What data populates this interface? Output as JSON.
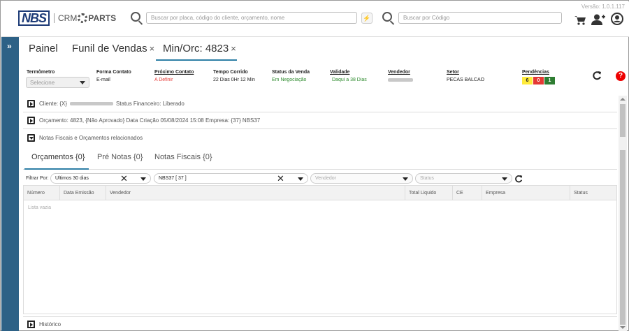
{
  "app": {
    "version": "Versão: 1.0.1.117",
    "logo_nbs": "NBS",
    "logo_crm": "CRM",
    "logo_parts": "PARTS"
  },
  "search": {
    "main_placeholder": "Buscar por placa, código do cliente, orçamento, nome",
    "code_placeholder": "Buscar por Código"
  },
  "tabs": [
    {
      "label": "Painel",
      "closable": false
    },
    {
      "label": "Funil de Vendas",
      "closable": true
    },
    {
      "label": "Min/Orc: 4823",
      "closable": true,
      "active": true
    }
  ],
  "close_glyph": "×",
  "info": {
    "termometro": {
      "label": "Termômetro",
      "value": "Selecione"
    },
    "forma_contato": {
      "label": "Forma Contato",
      "value": "E-mail"
    },
    "proximo_contato": {
      "label": "Próximo Contato",
      "value": "A Definir"
    },
    "tempo_corrido": {
      "label": "Tempo Corrido",
      "value": "22 Dias 0Hr 12 Min"
    },
    "status_venda": {
      "label": "Status da Venda",
      "value": "Em Negociação"
    },
    "validade": {
      "label": "Validade",
      "value": "Daqui a 38 Dias"
    },
    "vendedor": {
      "label": "Vendedor",
      "value": ""
    },
    "setor": {
      "label": "Setor",
      "value": "PECAS BALCAO"
    },
    "pendencias": {
      "label": "Pendências",
      "badges": [
        {
          "value": "6",
          "color": "#ffeb3b",
          "text_color": "#222"
        },
        {
          "value": "0",
          "color": "#e53935",
          "text_color": "#fff"
        },
        {
          "value": "1",
          "color": "#2e7d32",
          "text_color": "#fff"
        }
      ]
    }
  },
  "help_glyph": "?",
  "accordion": {
    "cliente": {
      "prefix": "Cliente: {X}",
      "suffix": "Status Financeiro: Liberado"
    },
    "orcamento": "Orçamento: 4823, {Não Aprovado} Data Criação 05/08/2024 15:08 Empresa: {37} NBS37",
    "notas": "Notas Fiscais e Orçamentos relacionados"
  },
  "subtabs": [
    "Orçamentos {0}",
    "Pré Notas {0}",
    "Notas Fiscais {0}"
  ],
  "filters": {
    "label": "Filtrar Por:",
    "period": "Ultimos 30 dias",
    "empresa": "NBS37 [ 37 ]",
    "vendedor_placeholder": "Vendedor",
    "status_placeholder": "Status"
  },
  "grid": {
    "columns": [
      "Número",
      "Data Emissão",
      "Vendedor",
      "Total Liquido",
      "CE",
      "Empresa",
      "Status"
    ],
    "empty": "Lista vazia"
  },
  "historico": "Histórico",
  "icons": [
    "search-icon",
    "filter-icon",
    "cart-icon",
    "add-user-icon",
    "user-account-icon",
    "refresh-icon",
    "help-icon",
    "chevron-right-icon"
  ]
}
